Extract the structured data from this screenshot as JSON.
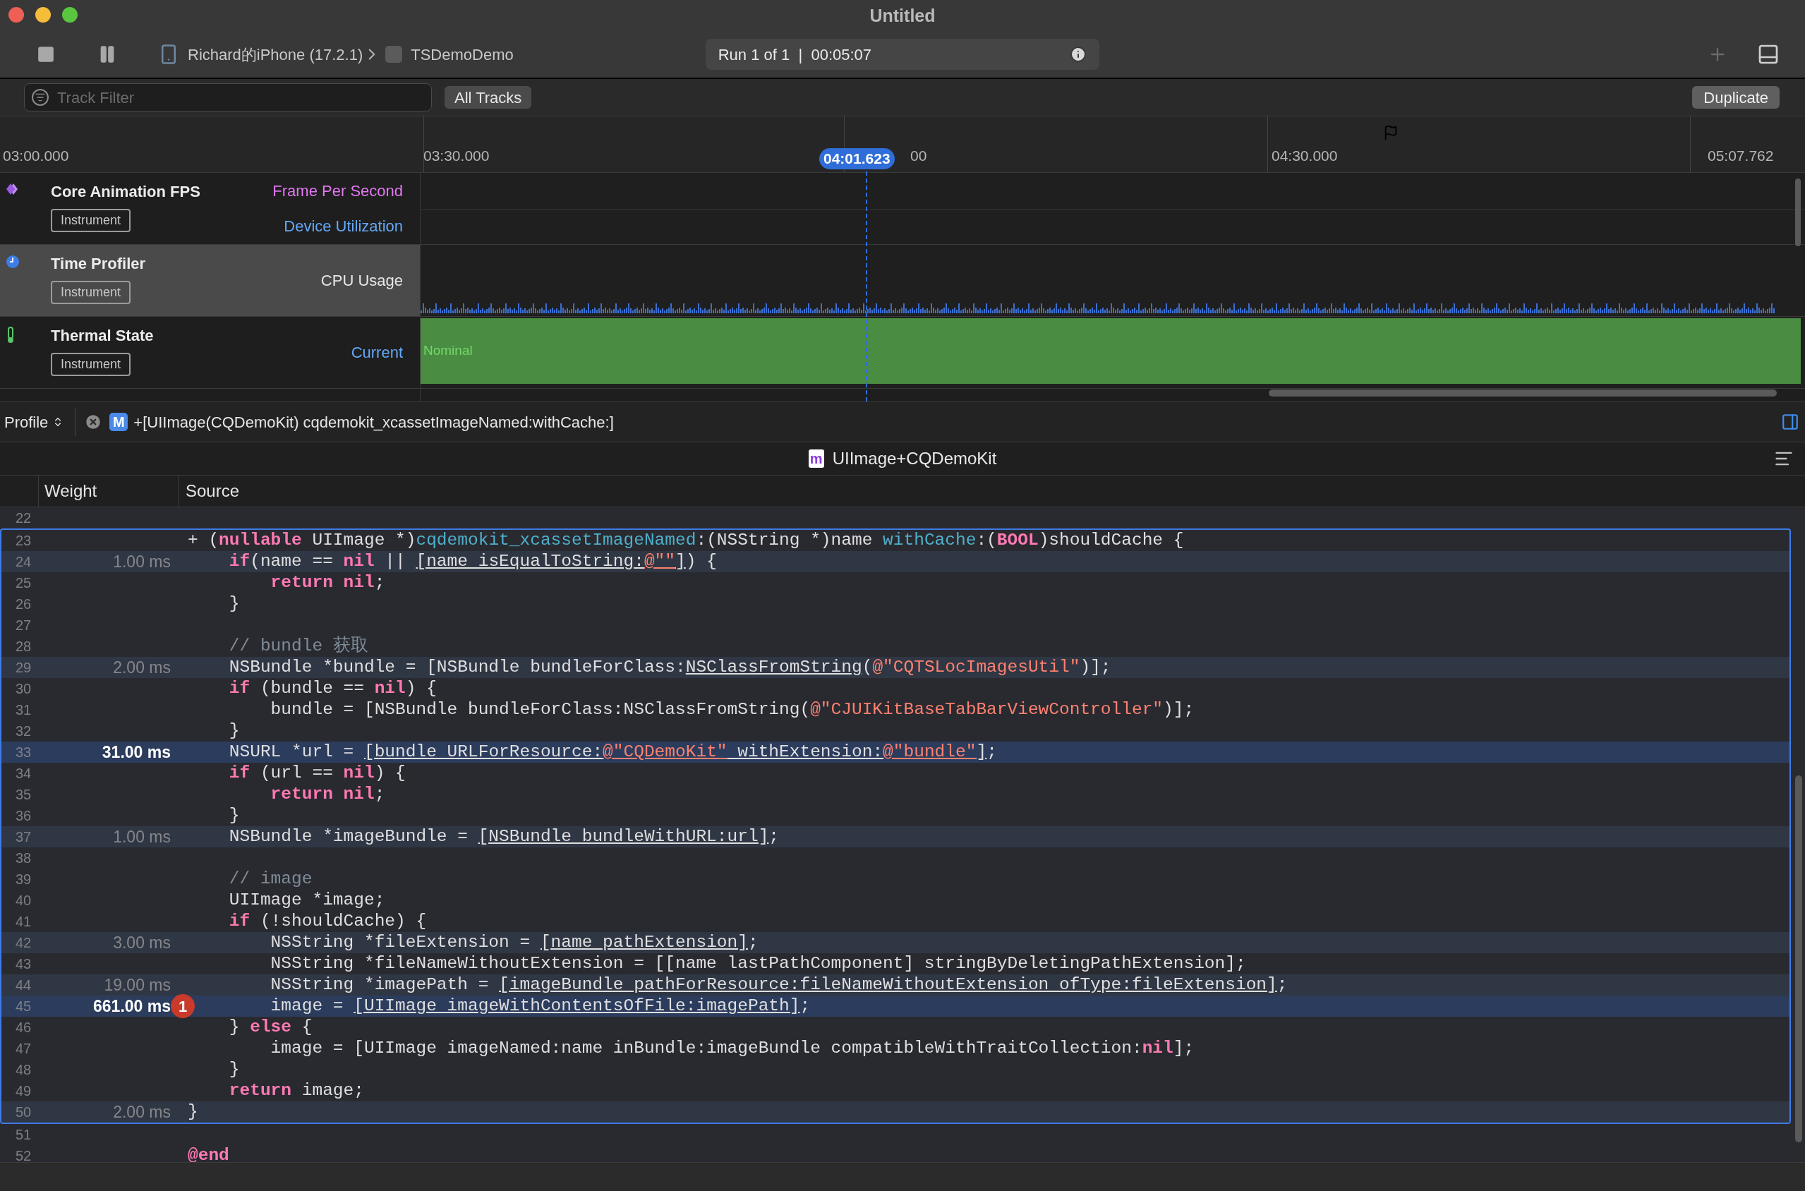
{
  "window": {
    "title": "Untitled"
  },
  "toolbar": {
    "device": "Richard的iPhone (17.2.1)",
    "app": "TSDemoDemo",
    "run_status": "Run 1 of 1  |  00:05:07"
  },
  "filter": {
    "placeholder": "Track Filter",
    "scope_button": "All Tracks",
    "duplicate_button": "Duplicate"
  },
  "timeline": {
    "ticks": [
      "03:00.000",
      "03:30.000",
      "00",
      "04:30.000",
      "05:07.762"
    ],
    "playhead": "04:01.623"
  },
  "tracks": [
    {
      "kind": "fps",
      "name": "Core Animation FPS",
      "tag": "Instrument",
      "selected": false,
      "labels": [
        {
          "text": "Frame Per Second",
          "color": "#e278f2"
        },
        {
          "text": "Device Utilization",
          "color": "#64a8f5"
        }
      ]
    },
    {
      "kind": "cpu",
      "name": "Time Profiler",
      "tag": "Instrument",
      "selected": true,
      "labels": [
        {
          "text": "CPU Usage",
          "color": "#e6e6e6"
        }
      ]
    },
    {
      "kind": "thermal",
      "name": "Thermal State",
      "tag": "Instrument",
      "selected": false,
      "labels": [
        {
          "text": "Current",
          "color": "#64a8f5"
        }
      ],
      "state": "Nominal"
    }
  ],
  "profile_bar": {
    "mode": "Profile",
    "symbol_badge": "M",
    "symbol": "+[UIImage(CQDemoKit) cqdemokit_xcassetImageNamed:withCache:]"
  },
  "source_view": {
    "file_badge": "m",
    "file_name": "UIImage+CQDemoKit",
    "columns": [
      "Weight",
      "Source"
    ],
    "lines_before": [
      {
        "number": "22",
        "highlighted": false,
        "hot": false
      }
    ],
    "selected_lines": [
      {
        "number": "23",
        "highlighted": false,
        "hot": false,
        "tokens": [
          {
            "kind": "plain",
            "text": "+ ("
          },
          {
            "kind": "keyword",
            "text": "nullable"
          },
          {
            "kind": "plain",
            "text": " UIImage *)"
          },
          {
            "kind": "decl",
            "text": "cqdemokit_xcassetImageNamed"
          },
          {
            "kind": "plain",
            "text": ":(NSString *)name "
          },
          {
            "kind": "decl",
            "text": "withCache"
          },
          {
            "kind": "plain",
            "text": ":("
          },
          {
            "kind": "keyword",
            "text": "BOOL"
          },
          {
            "kind": "plain",
            "text": ")shouldCache {"
          }
        ]
      },
      {
        "number": "24",
        "highlighted": true,
        "hot": false,
        "weight": "1.00 ms",
        "tokens": [
          {
            "kind": "keyword",
            "text": "    if"
          },
          {
            "kind": "plain",
            "text": "(name == "
          },
          {
            "kind": "keyword",
            "text": "nil"
          },
          {
            "kind": "plain",
            "text": " || "
          },
          {
            "kind": "link",
            "text": "[name isEqualToString:"
          },
          {
            "kind": "link_string",
            "text": "@\"\""
          },
          {
            "kind": "link",
            "text": "]"
          },
          {
            "kind": "plain",
            "text": ") {"
          }
        ]
      },
      {
        "number": "25",
        "highlighted": false,
        "hot": false,
        "tokens": [
          {
            "kind": "keyword",
            "text": "        return"
          },
          {
            "kind": "keyword",
            "text": " nil"
          },
          {
            "kind": "plain",
            "text": ";"
          }
        ]
      },
      {
        "number": "26",
        "highlighted": false,
        "hot": false,
        "tokens": [
          {
            "kind": "plain",
            "text": "    }"
          }
        ]
      },
      {
        "number": "27",
        "highlighted": false,
        "hot": false
      },
      {
        "number": "28",
        "highlighted": false,
        "hot": false,
        "tokens": [
          {
            "kind": "comment",
            "text": "    // bundle 获取"
          }
        ]
      },
      {
        "number": "29",
        "highlighted": true,
        "hot": false,
        "weight": "2.00 ms",
        "tokens": [
          {
            "kind": "plain",
            "text": "    NSBundle *bundle = [NSBundle bundleForClass:"
          },
          {
            "kind": "link",
            "text": "NSClassFromString"
          },
          {
            "kind": "plain",
            "text": "("
          },
          {
            "kind": "string",
            "text": "@\"CQTSLocImagesUtil\""
          },
          {
            "kind": "plain",
            "text": ")];"
          }
        ]
      },
      {
        "number": "30",
        "highlighted": false,
        "hot": false,
        "tokens": [
          {
            "kind": "keyword",
            "text": "    if"
          },
          {
            "kind": "plain",
            "text": " (bundle == "
          },
          {
            "kind": "keyword",
            "text": "nil"
          },
          {
            "kind": "plain",
            "text": ") {"
          }
        ]
      },
      {
        "number": "31",
        "highlighted": false,
        "hot": false,
        "tokens": [
          {
            "kind": "plain",
            "text": "        bundle = [NSBundle bundleForClass:NSClassFromString("
          },
          {
            "kind": "string",
            "text": "@\"CJUIKitBaseTabBarViewController\""
          },
          {
            "kind": "plain",
            "text": ")];"
          }
        ]
      },
      {
        "number": "32",
        "highlighted": false,
        "hot": false,
        "tokens": [
          {
            "kind": "plain",
            "text": "    }"
          }
        ]
      },
      {
        "number": "33",
        "highlighted": true,
        "hot": true,
        "weight": "31.00 ms",
        "tokens": [
          {
            "kind": "plain",
            "text": "    NSURL *url = "
          },
          {
            "kind": "link",
            "text": "[bundle URLForResource:"
          },
          {
            "kind": "link_string",
            "text": "@\"CQDemoKit\""
          },
          {
            "kind": "link",
            "text": " withExtension:"
          },
          {
            "kind": "link_string",
            "text": "@\"bundle\""
          },
          {
            "kind": "link",
            "text": "]"
          },
          {
            "kind": "plain",
            "text": ";"
          }
        ]
      },
      {
        "number": "34",
        "highlighted": false,
        "hot": false,
        "tokens": [
          {
            "kind": "keyword",
            "text": "    if"
          },
          {
            "kind": "plain",
            "text": " (url == "
          },
          {
            "kind": "keyword",
            "text": "nil"
          },
          {
            "kind": "plain",
            "text": ") {"
          }
        ]
      },
      {
        "number": "35",
        "highlighted": false,
        "hot": false,
        "tokens": [
          {
            "kind": "keyword",
            "text": "        return"
          },
          {
            "kind": "keyword",
            "text": " nil"
          },
          {
            "kind": "plain",
            "text": ";"
          }
        ]
      },
      {
        "number": "36",
        "highlighted": false,
        "hot": false,
        "tokens": [
          {
            "kind": "plain",
            "text": "    }"
          }
        ]
      },
      {
        "number": "37",
        "highlighted": true,
        "hot": false,
        "weight": "1.00 ms",
        "tokens": [
          {
            "kind": "plain",
            "text": "    NSBundle *imageBundle = "
          },
          {
            "kind": "link",
            "text": "[NSBundle bundleWithURL:url]"
          },
          {
            "kind": "plain",
            "text": ";"
          }
        ]
      },
      {
        "number": "38",
        "highlighted": false,
        "hot": false
      },
      {
        "number": "39",
        "highlighted": false,
        "hot": false,
        "tokens": [
          {
            "kind": "comment",
            "text": "    // image"
          }
        ]
      },
      {
        "number": "40",
        "highlighted": false,
        "hot": false,
        "tokens": [
          {
            "kind": "plain",
            "text": "    UIImage *image;"
          }
        ]
      },
      {
        "number": "41",
        "highlighted": false,
        "hot": false,
        "tokens": [
          {
            "kind": "keyword",
            "text": "    if"
          },
          {
            "kind": "plain",
            "text": " (!shouldCache) {"
          }
        ]
      },
      {
        "number": "42",
        "highlighted": true,
        "hot": false,
        "weight": "3.00 ms",
        "tokens": [
          {
            "kind": "plain",
            "text": "        NSString *fileExtension = "
          },
          {
            "kind": "link",
            "text": "[name pathExtension]"
          },
          {
            "kind": "plain",
            "text": ";"
          }
        ]
      },
      {
        "number": "43",
        "highlighted": false,
        "hot": false,
        "tokens": [
          {
            "kind": "plain",
            "text": "        NSString *fileNameWithoutExtension = [[name lastPathComponent] stringByDeletingPathExtension];"
          }
        ]
      },
      {
        "number": "44",
        "highlighted": true,
        "hot": false,
        "weight": "19.00 ms",
        "tokens": [
          {
            "kind": "plain",
            "text": "        NSString *imagePath = "
          },
          {
            "kind": "link",
            "text": "[imageBundle pathForResource:fileNameWithoutExtension ofType:fileExtension]"
          },
          {
            "kind": "plain",
            "text": ";"
          }
        ]
      },
      {
        "number": "45",
        "highlighted": true,
        "hot": true,
        "weight": "661.00 ms",
        "badge": "1",
        "tokens": [
          {
            "kind": "plain",
            "text": "        image = "
          },
          {
            "kind": "link",
            "text": "[UIImage imageWithContentsOfFile:imagePath]"
          },
          {
            "kind": "plain",
            "text": ";"
          }
        ]
      },
      {
        "number": "46",
        "highlighted": false,
        "hot": false,
        "tokens": [
          {
            "kind": "plain",
            "text": "    } "
          },
          {
            "kind": "keyword",
            "text": "else"
          },
          {
            "kind": "plain",
            "text": " {"
          }
        ]
      },
      {
        "number": "47",
        "highlighted": false,
        "hot": false,
        "tokens": [
          {
            "kind": "plain",
            "text": "        image = [UIImage imageNamed:name inBundle:imageBundle compatibleWithTraitCollection:"
          },
          {
            "kind": "keyword",
            "text": "nil"
          },
          {
            "kind": "plain",
            "text": "];"
          }
        ]
      },
      {
        "number": "48",
        "highlighted": false,
        "hot": false,
        "tokens": [
          {
            "kind": "plain",
            "text": "    }"
          }
        ]
      },
      {
        "number": "49",
        "highlighted": false,
        "hot": false,
        "tokens": [
          {
            "kind": "keyword",
            "text": "    return"
          },
          {
            "kind": "plain",
            "text": " image;"
          }
        ]
      },
      {
        "number": "50",
        "highlighted": true,
        "hot": false,
        "weight": "2.00 ms",
        "tokens": [
          {
            "kind": "plain",
            "text": "}"
          }
        ]
      }
    ],
    "lines_after": [
      {
        "number": "51",
        "highlighted": false,
        "hot": false
      },
      {
        "number": "52",
        "highlighted": false,
        "hot": false,
        "tokens": [
          {
            "kind": "keyword",
            "text": "@end"
          }
        ]
      }
    ]
  }
}
